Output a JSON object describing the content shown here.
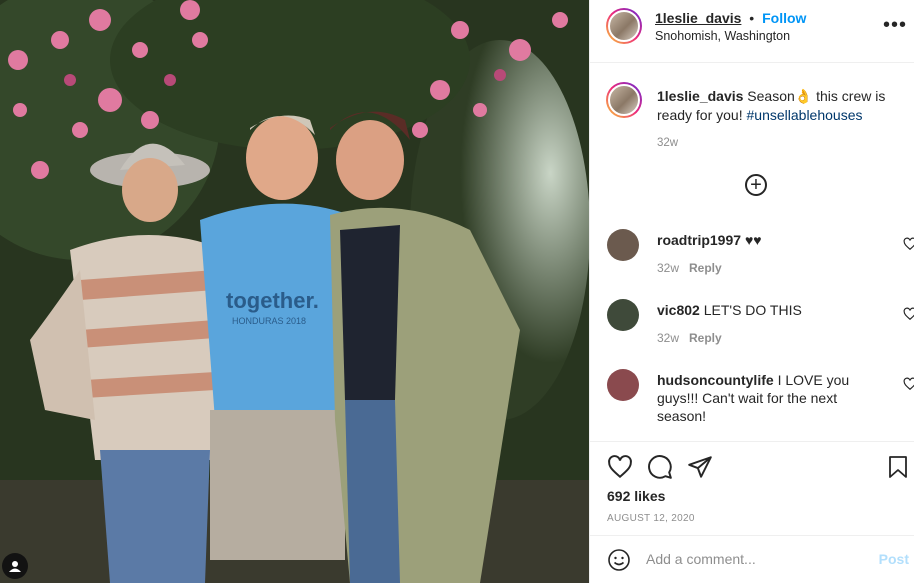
{
  "post": {
    "username": "1leslie_davis",
    "follow_label": "Follow",
    "separator": "•",
    "location": "Snohomish, Washington",
    "more_label": "•••",
    "caption_user": "1leslie_davis",
    "caption_before": "Season",
    "caption_emoji": "👌",
    "caption_after": " this crew is ready for you! ",
    "caption_hashtag": "#unsellablehouses",
    "caption_time": "32w",
    "load_more_label": "+",
    "photo_shirt_text": "together.",
    "photo_shirt_subtext": "HONDURAS 2018"
  },
  "comments": [
    {
      "user": "roadtrip1997",
      "text": "♥♥",
      "time": "32w",
      "reply": "Reply",
      "avatar_color": "#6b5a4e"
    },
    {
      "user": "vic802",
      "text": "LET'S DO THIS",
      "time": "32w",
      "reply": "Reply",
      "avatar_color": "#3f4a3a"
    },
    {
      "user": "hudsoncountylife",
      "text": "I LOVE you guys!!! Can't wait for the next season!",
      "time": "",
      "reply": "",
      "avatar_color": "#8a4a4e"
    }
  ],
  "footer": {
    "likes": "692 likes",
    "date": "AUGUST 12, 2020",
    "comment_placeholder": "Add a comment...",
    "post_label": "Post"
  },
  "icons": [
    "heart-icon",
    "comment-icon",
    "share-icon",
    "bookmark-icon",
    "emoji-icon",
    "user-tag-icon",
    "plus-circle-icon",
    "more-icon"
  ],
  "colors": {
    "follow": "#0095f6",
    "hashtag": "#00376b",
    "muted": "#8e8e8e",
    "post_disabled": "#b2dffc"
  }
}
